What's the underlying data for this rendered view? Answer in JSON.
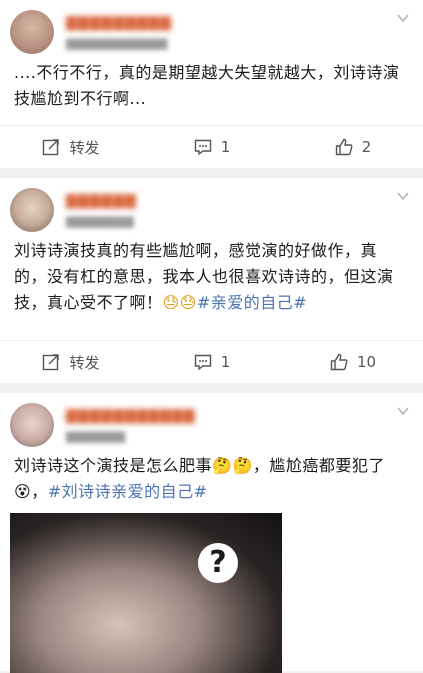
{
  "posts": [
    {
      "text": "....不行不行，真的是期望越大失望就越大，刘诗诗演技尴尬到不行啊...",
      "actions": {
        "repost": "转发",
        "comment": "1",
        "like": "2"
      }
    },
    {
      "text": "刘诗诗演技真的有些尴尬啊，感觉演的好做作，真的，没有杠的意思，我本人也很喜欢诗诗的，但这演技，真心受不了啊！",
      "emoji": "😓😓",
      "topic": "#亲爱的自己#",
      "actions": {
        "repost": "转发",
        "comment": "1",
        "like": "10"
      }
    },
    {
      "text": "刘诗诗这个演技是怎么肥事",
      "emoji": "🤔🤔",
      "text2": "，尴尬癌都要犯了",
      "emoji2": "😵",
      "text3": "，",
      "topic": "#刘诗诗亲爱的自己#"
    }
  ],
  "icons": {
    "repost": "repost-icon",
    "comment": "comment-icon",
    "like": "like-icon",
    "more": "chevron-down-icon"
  },
  "colors": {
    "topic": "#4c74b3",
    "username": "#d9663d"
  }
}
